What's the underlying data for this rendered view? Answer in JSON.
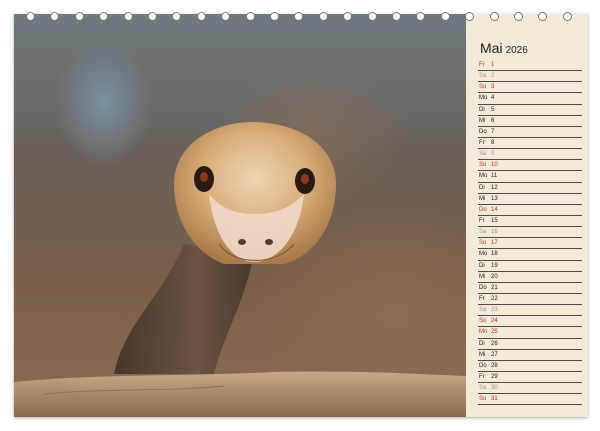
{
  "calendar": {
    "month": "Mai",
    "year": "2026",
    "days": [
      {
        "weekday": "Fr",
        "day": "1",
        "type": "sun"
      },
      {
        "weekday": "Sa",
        "day": "2",
        "type": "sat"
      },
      {
        "weekday": "So",
        "day": "3",
        "type": "sun"
      },
      {
        "weekday": "Mo",
        "day": "4",
        "type": "norm"
      },
      {
        "weekday": "Di",
        "day": "5",
        "type": "norm"
      },
      {
        "weekday": "Mi",
        "day": "6",
        "type": "norm"
      },
      {
        "weekday": "Do",
        "day": "7",
        "type": "norm"
      },
      {
        "weekday": "Fr",
        "day": "8",
        "type": "norm"
      },
      {
        "weekday": "Sa",
        "day": "9",
        "type": "sat"
      },
      {
        "weekday": "So",
        "day": "10",
        "type": "sun"
      },
      {
        "weekday": "Mo",
        "day": "11",
        "type": "norm"
      },
      {
        "weekday": "Di",
        "day": "12",
        "type": "norm"
      },
      {
        "weekday": "Mi",
        "day": "13",
        "type": "norm"
      },
      {
        "weekday": "Do",
        "day": "14",
        "type": "sun"
      },
      {
        "weekday": "Fr",
        "day": "15",
        "type": "norm"
      },
      {
        "weekday": "Sa",
        "day": "16",
        "type": "sat"
      },
      {
        "weekday": "So",
        "day": "17",
        "type": "sun"
      },
      {
        "weekday": "Mo",
        "day": "18",
        "type": "norm"
      },
      {
        "weekday": "Di",
        "day": "19",
        "type": "norm"
      },
      {
        "weekday": "Mi",
        "day": "20",
        "type": "norm"
      },
      {
        "weekday": "Do",
        "day": "21",
        "type": "norm"
      },
      {
        "weekday": "Fr",
        "day": "22",
        "type": "norm"
      },
      {
        "weekday": "Sa",
        "day": "23",
        "type": "sat"
      },
      {
        "weekday": "So",
        "day": "24",
        "type": "sun"
      },
      {
        "weekday": "Mo",
        "day": "25",
        "type": "sun"
      },
      {
        "weekday": "Di",
        "day": "26",
        "type": "norm"
      },
      {
        "weekday": "Mi",
        "day": "27",
        "type": "norm"
      },
      {
        "weekday": "Do",
        "day": "28",
        "type": "norm"
      },
      {
        "weekday": "Fr",
        "day": "29",
        "type": "norm"
      },
      {
        "weekday": "Sa",
        "day": "30",
        "type": "sat"
      },
      {
        "weekday": "So",
        "day": "31",
        "type": "sun"
      }
    ]
  },
  "colors": {
    "page": "#f3ead8",
    "weekday_text": "#222222",
    "saturday_text": "#9a9a9a",
    "holiday_text": "#c8302a",
    "line": "#4a4a4a"
  }
}
